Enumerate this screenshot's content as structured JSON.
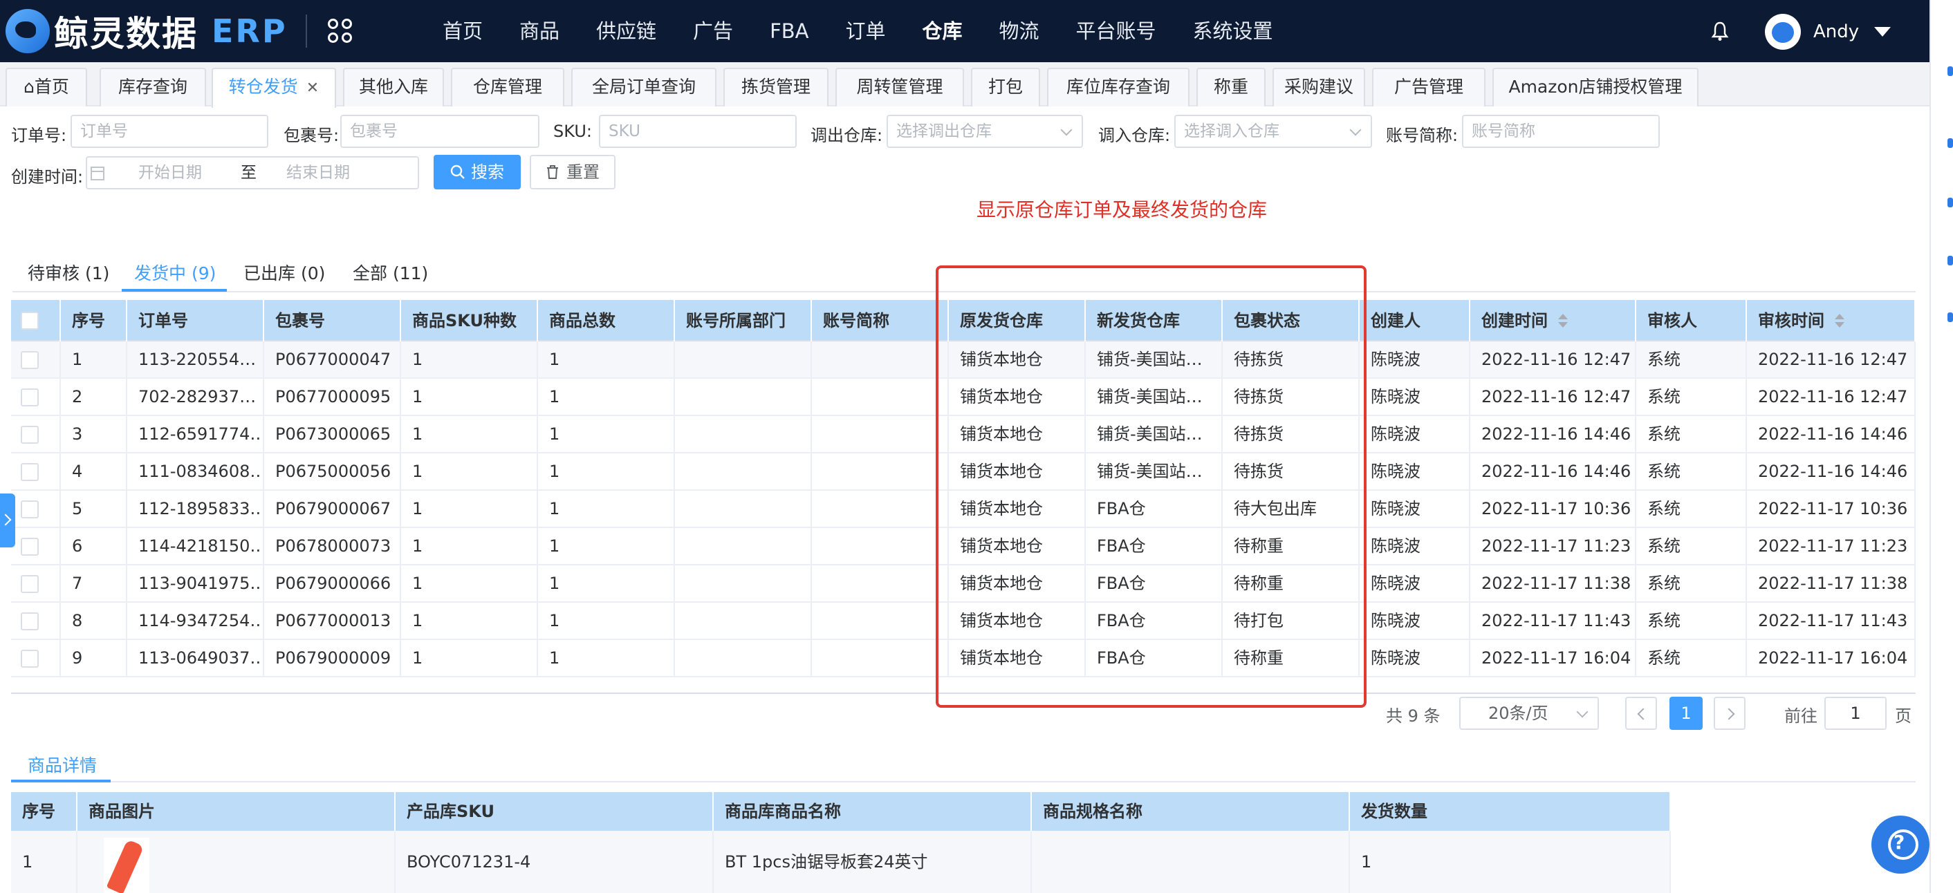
{
  "app": {
    "brand": "鲸灵数据",
    "erp": "ERP",
    "user": "Andy"
  },
  "nav": [
    "首页",
    "商品",
    "供应链",
    "广告",
    "FBA",
    "订单",
    "仓库",
    "物流",
    "平台账号",
    "系统设置"
  ],
  "nav_active": "仓库",
  "page_tabs": [
    "首页",
    "库存查询",
    "转仓发货",
    "其他入库",
    "仓库管理",
    "全局订单查询",
    "拣货管理",
    "周转筐管理",
    "打包",
    "库位库存查询",
    "称重",
    "采购建议",
    "广告管理",
    "Amazon店铺授权管理"
  ],
  "page_tab_active": "转仓发货",
  "filters": {
    "order_no": {
      "label": "订单号:",
      "placeholder": "订单号"
    },
    "package_no": {
      "label": "包裹号:",
      "placeholder": "包裹号"
    },
    "sku": {
      "label": "SKU:",
      "placeholder": "SKU"
    },
    "out_wh": {
      "label": "调出仓库:",
      "placeholder": "选择调出仓库"
    },
    "in_wh": {
      "label": "调入仓库:",
      "placeholder": "选择调入仓库"
    },
    "account": {
      "label": "账号简称:",
      "placeholder": "账号简称"
    },
    "created": {
      "label": "创建时间:",
      "start": "开始日期",
      "to": "至",
      "end": "结束日期"
    },
    "search": "搜索",
    "reset": "重置"
  },
  "annotation": "显示原仓库订单及最终发货的仓库",
  "status_tabs": [
    "待审核 (1)",
    "发货中 (9)",
    "已出库 (0)",
    "全部 (11)"
  ],
  "status_tab_active": "发货中 (9)",
  "table": {
    "columns": [
      "序号",
      "订单号",
      "包裹号",
      "商品SKU种数",
      "商品总数",
      "账号所属部门",
      "账号简称",
      "原发货仓库",
      "新发货仓库",
      "包裹状态",
      "创建人",
      "创建时间",
      "审核人",
      "审核时间"
    ],
    "rows": [
      [
        "1",
        "113-220554…",
        "P0677000047",
        "1",
        "1",
        "",
        "",
        "铺货本地仓",
        "铺货-美国站…",
        "待拣货",
        "陈晓波",
        "2022-11-16 12:47",
        "系统",
        "2022-11-16 12:47"
      ],
      [
        "2",
        "702-282937…",
        "P0677000095",
        "1",
        "1",
        "",
        "",
        "铺货本地仓",
        "铺货-美国站…",
        "待拣货",
        "陈晓波",
        "2022-11-16 12:47",
        "系统",
        "2022-11-16 12:47"
      ],
      [
        "3",
        "112-6591774…",
        "P0673000065",
        "1",
        "1",
        "",
        "",
        "铺货本地仓",
        "铺货-美国站…",
        "待拣货",
        "陈晓波",
        "2022-11-16 14:46",
        "系统",
        "2022-11-16 14:46"
      ],
      [
        "4",
        "111-0834608…",
        "P0675000056",
        "1",
        "1",
        "",
        "",
        "铺货本地仓",
        "铺货-美国站…",
        "待拣货",
        "陈晓波",
        "2022-11-16 14:46",
        "系统",
        "2022-11-16 14:46"
      ],
      [
        "5",
        "112-1895833…",
        "P0679000067",
        "1",
        "1",
        "",
        "",
        "铺货本地仓",
        "FBA仓",
        "待大包出库",
        "陈晓波",
        "2022-11-17 10:36",
        "系统",
        "2022-11-17 10:36"
      ],
      [
        "6",
        "114-4218150…",
        "P0678000073",
        "1",
        "1",
        "",
        "",
        "铺货本地仓",
        "FBA仓",
        "待称重",
        "陈晓波",
        "2022-11-17 11:23",
        "系统",
        "2022-11-17 11:23"
      ],
      [
        "7",
        "113-9041975…",
        "P0679000066",
        "1",
        "1",
        "",
        "",
        "铺货本地仓",
        "FBA仓",
        "待称重",
        "陈晓波",
        "2022-11-17 11:38",
        "系统",
        "2022-11-17 11:38"
      ],
      [
        "8",
        "114-9347254…",
        "P0677000013",
        "1",
        "1",
        "",
        "",
        "铺货本地仓",
        "FBA仓",
        "待打包",
        "陈晓波",
        "2022-11-17 11:43",
        "系统",
        "2022-11-17 11:43"
      ],
      [
        "9",
        "113-0649037…",
        "P0679000009",
        "1",
        "1",
        "",
        "",
        "铺货本地仓",
        "FBA仓",
        "待称重",
        "陈晓波",
        "2022-11-17 16:04",
        "系统",
        "2022-11-17 16:04"
      ]
    ]
  },
  "pagination": {
    "total": "共 9 条",
    "page_size": "20条/页",
    "current": "1",
    "goto": "前往",
    "goto_value": "1",
    "page_unit": "页"
  },
  "detail": {
    "tab": "商品详情",
    "columns": [
      "序号",
      "商品图片",
      "产品库SKU",
      "商品库商品名称",
      "商品规格名称",
      "发货数量"
    ],
    "rows": [
      [
        "1",
        "",
        "BOYC071231-4",
        "BT 1pcs油锯导板套24英寸",
        "",
        "1"
      ]
    ]
  },
  "colors": {
    "nav_bg": "#0c1b33",
    "primary": "#409eff",
    "header_bg": "#bcdcf7",
    "annotation": "#e02f26"
  }
}
